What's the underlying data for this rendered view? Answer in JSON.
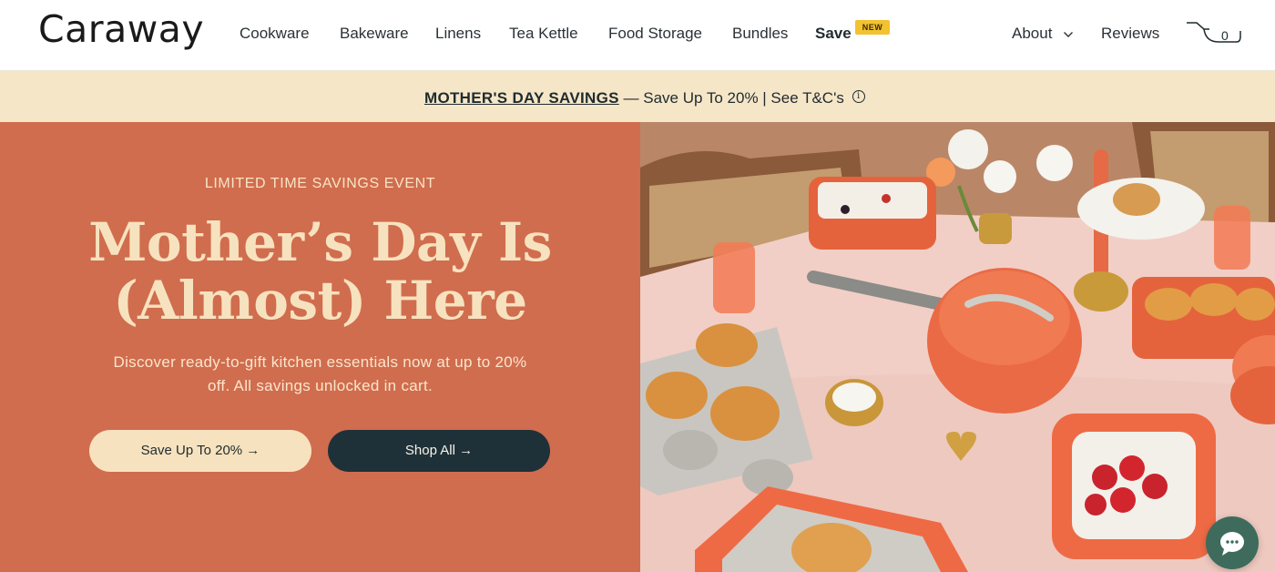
{
  "header": {
    "logo": "Caraway",
    "nav": [
      {
        "label": "Cookware"
      },
      {
        "label": "Bakeware"
      },
      {
        "label": "Linens"
      },
      {
        "label": "Tea Kettle"
      },
      {
        "label": "Food Storage"
      },
      {
        "label": "Bundles"
      },
      {
        "label": "Save",
        "badge": "NEW"
      }
    ],
    "about_label": "About",
    "reviews_label": "Reviews",
    "cart_count": "0"
  },
  "promo": {
    "link_text": "MOTHER'S DAY SAVINGS",
    "rest_text": "— Save Up To 20% | See T&C's",
    "info_icon": "info-icon"
  },
  "hero": {
    "eyebrow": "LIMITED TIME SAVINGS EVENT",
    "headline_line1": "Mother’s Day Is",
    "headline_line2": "(Almost) Here",
    "subcopy": "Discover ready-to-gift kitchen essentials now at up to 20% off. All savings unlocked in cart.",
    "primary_button": "Save Up To 20% →",
    "secondary_button": "Shop All →",
    "image_icon": "hero-table-image"
  },
  "colors": {
    "hero_bg": "#d06d4e",
    "promo_bg": "#f6e6c8",
    "cream": "#f7e2bf",
    "dark_button": "#1f3138",
    "new_badge": "#f2c230",
    "chat": "#3e6b5c"
  },
  "chat": {
    "icon": "chat-bubble-icon"
  }
}
